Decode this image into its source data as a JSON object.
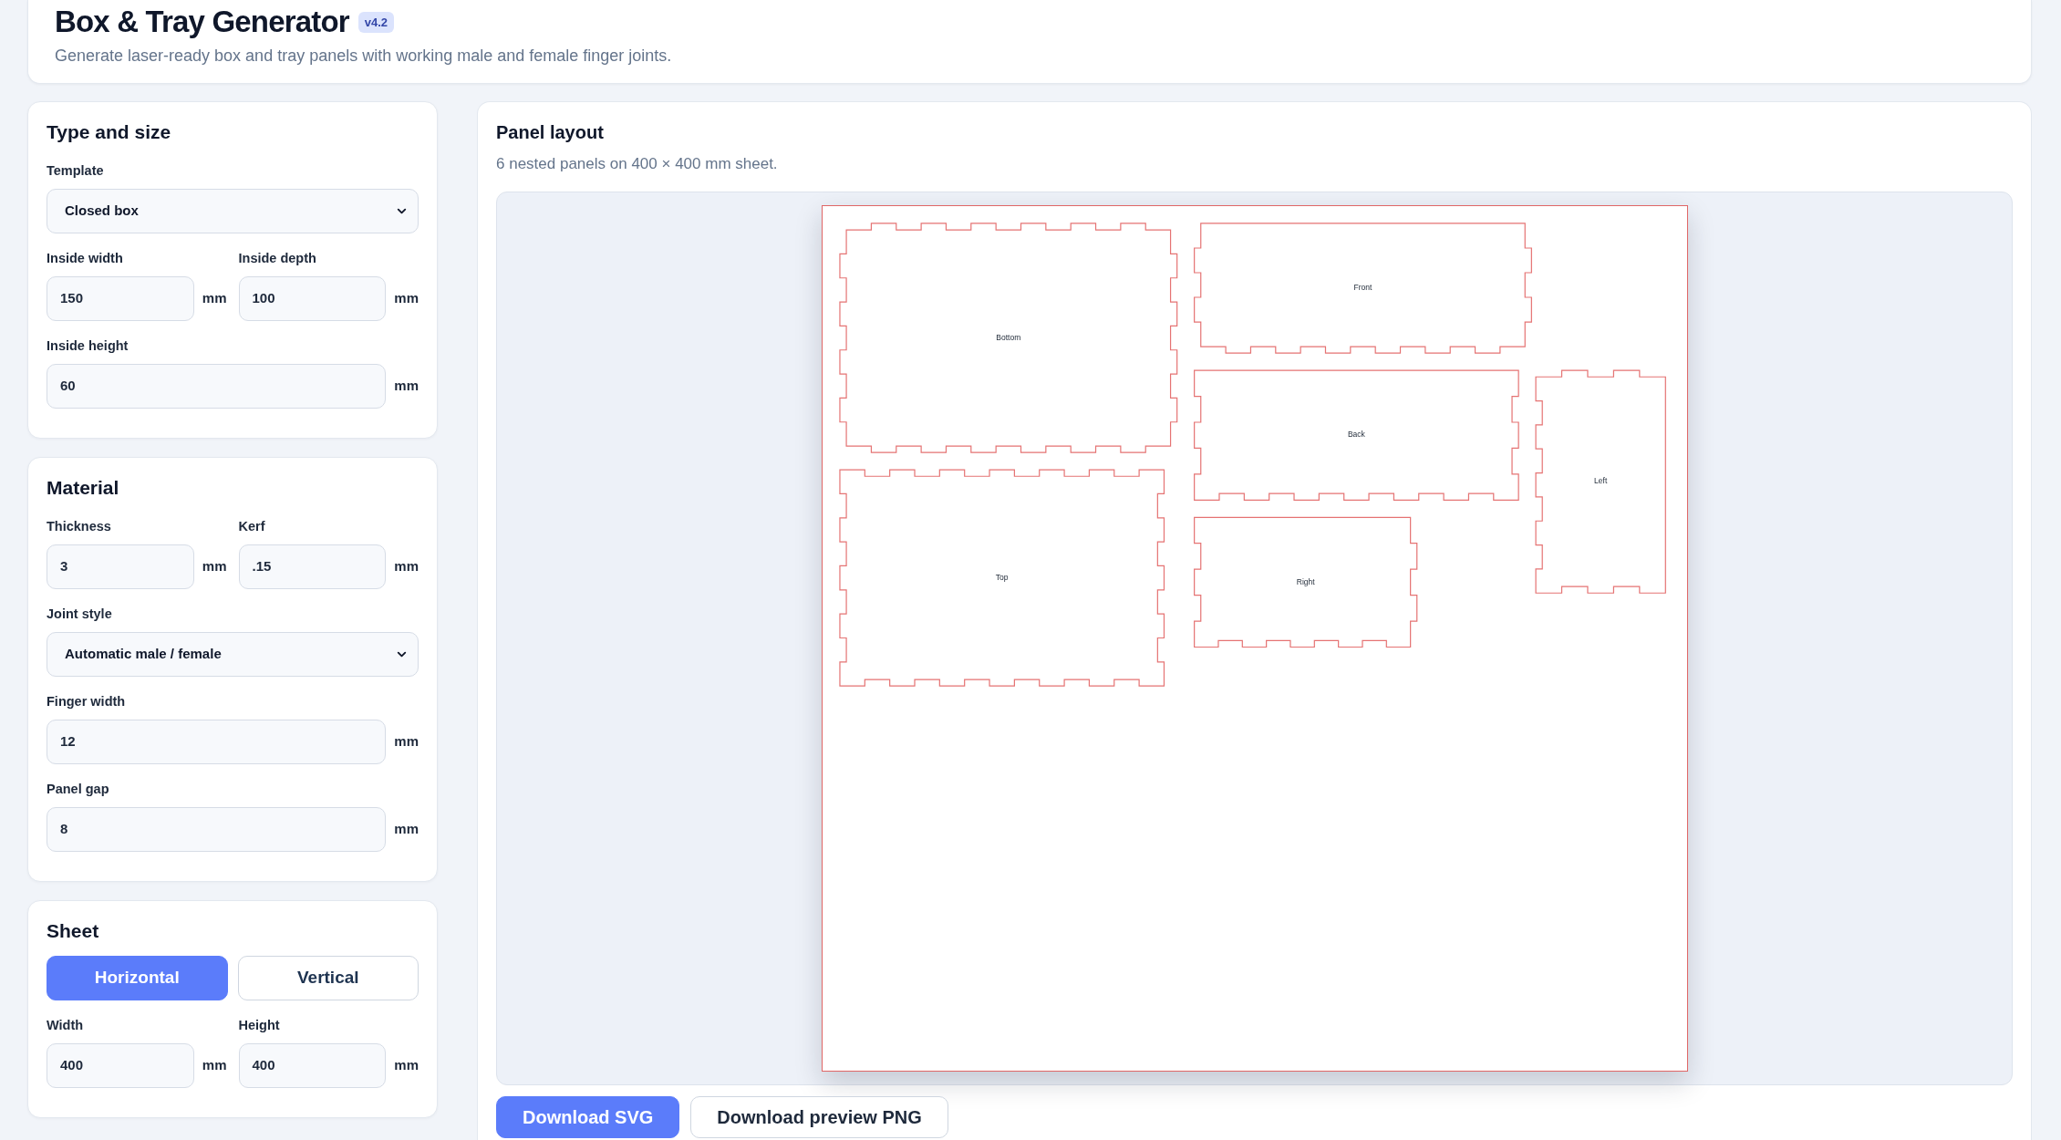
{
  "header": {
    "title": "Box & Tray Generator",
    "version": "v4.2",
    "subtitle": "Generate laser-ready box and tray panels with working male and female finger joints."
  },
  "settings": [
    {
      "title": "Type and size",
      "fields": [
        {
          "kind": "select",
          "label": "Template",
          "value": "Closed box"
        },
        {
          "kind": "pair",
          "items": [
            {
              "label": "Inside width",
              "value": "150",
              "unit": "mm"
            },
            {
              "label": "Inside depth",
              "value": "100",
              "unit": "mm"
            }
          ]
        },
        {
          "kind": "number",
          "label": "Inside height",
          "value": "60",
          "unit": "mm"
        }
      ]
    },
    {
      "title": "Material",
      "fields": [
        {
          "kind": "pair",
          "items": [
            {
              "label": "Thickness",
              "value": "3",
              "unit": "mm"
            },
            {
              "label": "Kerf",
              "value": ".15",
              "unit": "mm"
            }
          ]
        },
        {
          "kind": "select",
          "label": "Joint style",
          "value": "Automatic male / female"
        },
        {
          "kind": "number",
          "label": "Finger width",
          "value": "12",
          "unit": "mm"
        },
        {
          "kind": "number",
          "label": "Panel gap",
          "value": "8",
          "unit": "mm"
        }
      ]
    },
    {
      "title": "Sheet",
      "fields": [
        {
          "kind": "toggle",
          "options": [
            {
              "label": "Horizontal",
              "selected": true
            },
            {
              "label": "Vertical",
              "selected": false
            }
          ]
        },
        {
          "kind": "pair",
          "items": [
            {
              "label": "Width",
              "value": "400",
              "unit": "mm"
            },
            {
              "label": "Height",
              "value": "400",
              "unit": "mm"
            }
          ]
        }
      ]
    }
  ],
  "layout": {
    "title": "Panel layout",
    "summary": "6 nested panels on 400 × 400 mm sheet.",
    "panels": [
      {
        "label": "Bottom"
      },
      {
        "label": "Front"
      },
      {
        "label": "Back"
      },
      {
        "label": "Left"
      },
      {
        "label": "Top"
      },
      {
        "label": "Right"
      }
    ],
    "actions": [
      {
        "label": "Download SVG",
        "kind": "primary"
      },
      {
        "label": "Download preview PNG",
        "kind": "secondary"
      }
    ]
  }
}
